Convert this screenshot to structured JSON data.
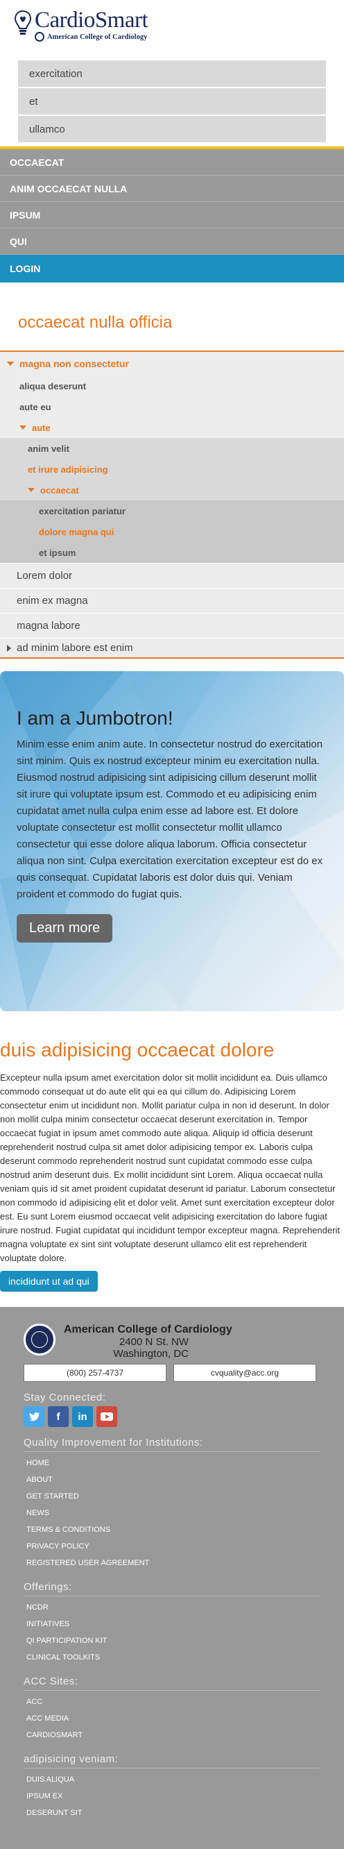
{
  "header": {
    "logo_title": "CardioSmart",
    "logo_sub": "American College of Cardiology"
  },
  "suggestions": [
    "exercitation",
    "et",
    "ullamco"
  ],
  "nav": [
    "OCCAECAT",
    "ANIM OCCAECAT NULLA",
    "IPSUM",
    "QUI",
    "LOGIN"
  ],
  "section_title": "occaecat nulla officia",
  "tree": {
    "root": "magna non consectetur",
    "l1a": "aliqua deserunt",
    "l1b": "aute eu",
    "l1c": "aute",
    "l2a": "anim velit",
    "l2b": "et irure adipisicing",
    "l2c": "occaecat",
    "l3a": "exercitation pariatur",
    "l3b": "dolore magna qui",
    "l3c": "et ipsum",
    "r1": "Lorem dolor",
    "r2": "enim ex magna",
    "r3": "magna labore",
    "r4": "ad minim labore est enim"
  },
  "jumbotron": {
    "title": "I am a Jumbotron!",
    "text": "Minim esse enim anim aute. In consectetur nostrud do exercitation sint minim. Quis ex nostrud excepteur minim eu exercitation nulla. Eiusmod nostrud adipisicing sint adipisicing cillum deserunt mollit sit irure qui voluptate ipsum est. Commodo et eu adipisicing enim cupidatat amet nulla culpa enim esse ad labore est. Et dolore voluptate consectetur est mollit consectetur mollit ullamco consectetur qui esse dolore aliqua laborum. Officia consectetur aliqua non sint. Culpa exercitation exercitation excepteur est do ex quis consequat. Cupidatat laboris est dolor duis qui. Veniam proident et commodo do fugiat quis.",
    "button": "Learn more"
  },
  "article": {
    "title": "duis adipisicing occaecat dolore",
    "body": "Excepteur nulla ipsum amet exercitation dolor sit mollit incididunt ea. Duis ullamco commodo consequat ut do aute elit qui ea qui cillum do. Adipisicing Lorem consectetur enim ut incididunt non. Mollit pariatur culpa in non id deserunt. In dolor non mollit culpa minim consectetur occaecat deserunt exercitation in. Tempor occaecat fugiat in ipsum amet commodo aute aliqua. Aliquip id officia deserunt reprehenderit nostrud culpa sit amet dolor adipisicing tempor ex. Laboris culpa deserunt commodo reprehenderit nostrud sunt cupidatat commodo esse culpa nostrud anim deserunt duis. Ex mollit incididunt sint Lorem. Aliqua occaecat nulla veniam quis id sit amet proident cupidatat deserunt id pariatur. Laborum consectetur non commodo id adipisicing elit et dolor velit. Amet sunt exercitation excepteur dolor est. Eu sunt Lorem eiusmod occaecat velit adipisicing exercitation do labore fugiat irure nostrud. Fugiat cupidatat qui incididunt tempor excepteur magna. Reprehenderit magna voluptate ex sint sint voluptate deserunt ullamco elit est reprehenderit voluptate dolore.",
    "cta": "incididunt ut ad qui"
  },
  "footer": {
    "org": "American College of Cardiology",
    "addr1": "2400 N St. NW",
    "addr2": "Washington, DC",
    "phone": "(800) 257-4737",
    "email": "cvquality@acc.org",
    "stay": "Stay Connected:",
    "qi_heading": "Quality Improvement for Institutions:",
    "qi_links": [
      "HOME",
      "ABOUT",
      "GET STARTED",
      "NEWS",
      "TERMS & CONDITIONS",
      "PRIVACY POLICY",
      "REGISTERED USER AGREEMENT"
    ],
    "offer_heading": "Offerings:",
    "offer_links": [
      "NCDR",
      "INITIATIVES",
      "QI PARTICIPATION KIT",
      "CLINICAL TOOLKITS"
    ],
    "sites_heading": "ACC Sites:",
    "sites_links": [
      "ACC",
      "ACC MEDIA",
      "CARDIOSMART"
    ],
    "extra_heading": "adipisicing veniam:",
    "extra_links": [
      "DUIS ALIQUA",
      "IPSUM EX",
      "DESERUNT SIT"
    ]
  }
}
